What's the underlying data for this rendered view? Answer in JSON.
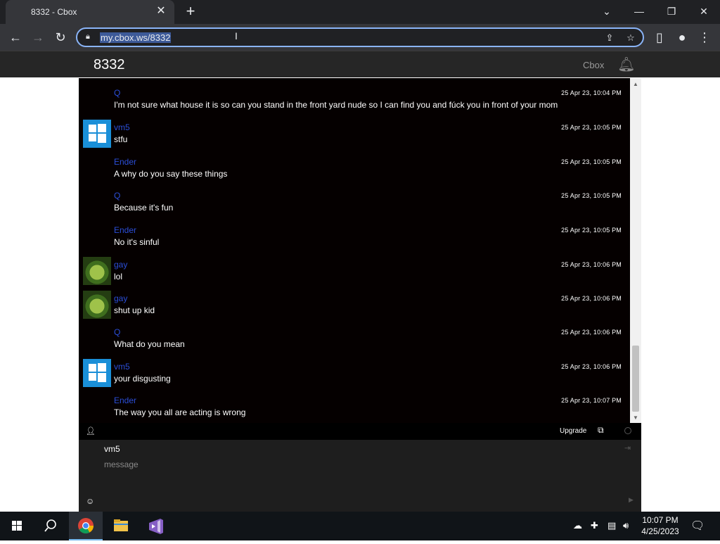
{
  "browser": {
    "tab_title": "8332 - Cbox",
    "tab_close": "✕",
    "new_tab": "+",
    "url": "my.cbox.ws/8332"
  },
  "site": {
    "title": "8332",
    "brand": "Cbox"
  },
  "messages": [
    {
      "author": "Q",
      "text": "I'm not sure what house it is so can you stand in the front yard nude so I can find you and fúck you in front of your mom",
      "time": "25 Apr 23, 10:04 PM",
      "avatar": "none"
    },
    {
      "author": "vm5",
      "text": "stfu",
      "time": "25 Apr 23, 10:05 PM",
      "avatar": "windows-logo"
    },
    {
      "author": "Ender",
      "text": "A why do you say these things",
      "time": "25 Apr 23, 10:05 PM",
      "avatar": "none"
    },
    {
      "author": "Q",
      "text": "Because it's fun",
      "time": "25 Apr 23, 10:05 PM",
      "avatar": "none"
    },
    {
      "author": "Ender",
      "text": "No it's sinful",
      "time": "25 Apr 23, 10:05 PM",
      "avatar": "none"
    },
    {
      "author": "gay",
      "text": "lol",
      "time": "25 Apr 23, 10:06 PM",
      "avatar": "green-photo"
    },
    {
      "author": "gay",
      "text": "shut up kid",
      "time": "25 Apr 23, 10:06 PM",
      "avatar": "green-photo"
    },
    {
      "author": "Q",
      "text": "What do you mean",
      "time": "25 Apr 23, 10:06 PM",
      "avatar": "none"
    },
    {
      "author": "vm5",
      "text": "your disgusting",
      "time": "25 Apr 23, 10:06 PM",
      "avatar": "windows-logo"
    },
    {
      "author": "Ender",
      "text": "The way you all are acting is wrong",
      "time": "25 Apr 23, 10:07 PM",
      "avatar": "none"
    }
  ],
  "footer": {
    "upgrade": "Upgrade"
  },
  "compose": {
    "name": "vm5",
    "message_placeholder": "message"
  },
  "taskbar": {
    "time": "10:07 PM",
    "date": "4/25/2023"
  },
  "colors": {
    "author": "#2b4ed8",
    "chat_bg": "#050000",
    "focus_ring": "#8ab4f8"
  }
}
